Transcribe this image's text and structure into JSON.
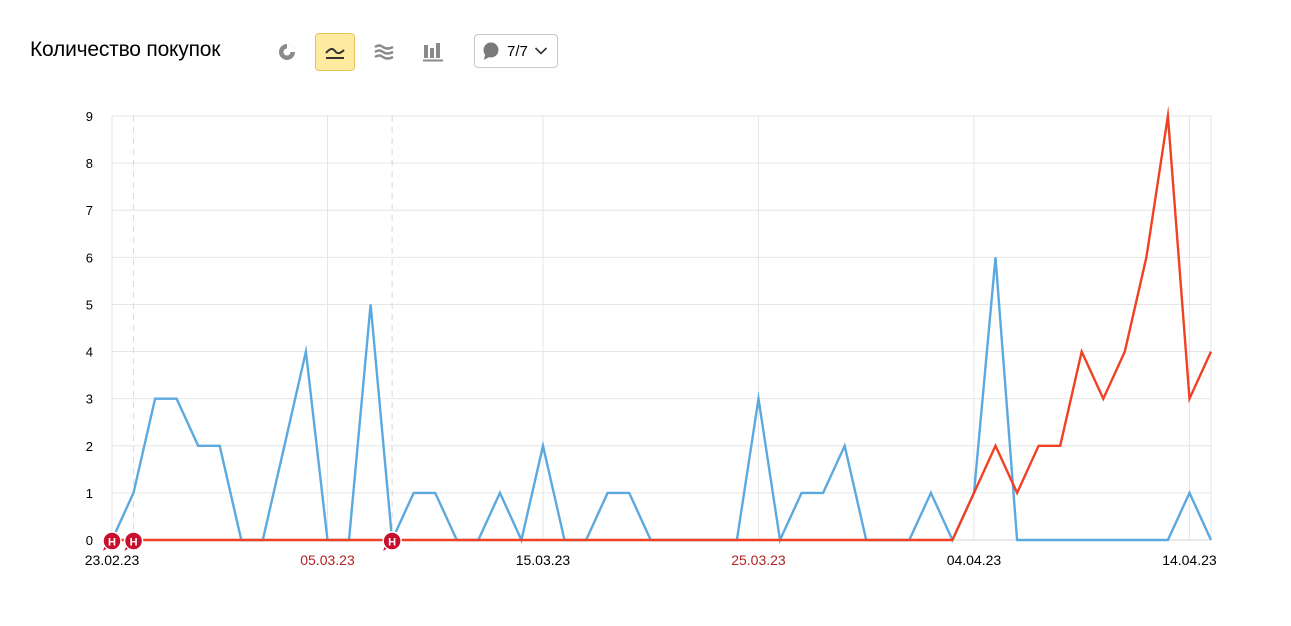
{
  "header": {
    "title": "Количество покупок",
    "notes_count": "7/7"
  },
  "toolbar": {
    "buttons": [
      {
        "icon": "pie-chart-icon",
        "active": false
      },
      {
        "icon": "line-chart-icon",
        "active": true
      },
      {
        "icon": "area-chart-icon",
        "active": false
      },
      {
        "icon": "bar-chart-icon",
        "active": false
      }
    ]
  },
  "colors": {
    "series_blue": "#5ca9e0",
    "series_red": "#f04124",
    "note_marker": "#c8102e",
    "holiday_label": "#b22222",
    "active_button": "#ffeba0"
  },
  "chart_data": {
    "type": "line",
    "x": [
      "23.02.23",
      "24.02.23",
      "25.02.23",
      "26.02.23",
      "27.02.23",
      "28.02.23",
      "01.03.23",
      "02.03.23",
      "03.03.23",
      "04.03.23",
      "05.03.23",
      "06.03.23",
      "07.03.23",
      "08.03.23",
      "09.03.23",
      "10.03.23",
      "11.03.23",
      "12.03.23",
      "13.03.23",
      "14.03.23",
      "15.03.23",
      "16.03.23",
      "17.03.23",
      "18.03.23",
      "19.03.23",
      "20.03.23",
      "21.03.23",
      "22.03.23",
      "23.03.23",
      "24.03.23",
      "25.03.23",
      "26.03.23",
      "27.03.23",
      "28.03.23",
      "29.03.23",
      "30.03.23",
      "31.03.23",
      "01.04.23",
      "02.04.23",
      "03.04.23",
      "04.04.23",
      "05.04.23",
      "06.04.23",
      "07.04.23",
      "08.04.23",
      "09.04.23",
      "10.04.23",
      "11.04.23",
      "12.04.23",
      "13.04.23",
      "14.04.23",
      "15.04.23"
    ],
    "series": [
      {
        "color": "#5ca9e0",
        "values": [
          0,
          1,
          3,
          3,
          2,
          2,
          0,
          0,
          2,
          4,
          0,
          0,
          5,
          0,
          1,
          1,
          0,
          0,
          1,
          0,
          2,
          0,
          0,
          1,
          1,
          0,
          0,
          0,
          0,
          0,
          3,
          0,
          1,
          1,
          2,
          0,
          0,
          0,
          1,
          0,
          1,
          6,
          0,
          0,
          0,
          0,
          0,
          0,
          0,
          0,
          1,
          0
        ]
      },
      {
        "color": "#f04124",
        "values": [
          0,
          0,
          0,
          0,
          0,
          0,
          0,
          0,
          0,
          0,
          0,
          0,
          0,
          0,
          0,
          0,
          0,
          0,
          0,
          0,
          0,
          0,
          0,
          0,
          0,
          0,
          0,
          0,
          0,
          0,
          0,
          0,
          0,
          0,
          0,
          0,
          0,
          0,
          0,
          0,
          1,
          2,
          1,
          2,
          2,
          4,
          3,
          4,
          6,
          9,
          3,
          4
        ]
      }
    ],
    "ylim": [
      0,
      9
    ],
    "yticks": [
      "0",
      "1",
      "2",
      "3",
      "4",
      "5",
      "6",
      "7",
      "8",
      "9"
    ],
    "xticks": [
      {
        "index": 0,
        "label": "23.02.23",
        "holiday": false
      },
      {
        "index": 10,
        "label": "05.03.23",
        "holiday": true
      },
      {
        "index": 20,
        "label": "15.03.23",
        "holiday": false
      },
      {
        "index": 30,
        "label": "25.03.23",
        "holiday": true
      },
      {
        "index": 40,
        "label": "04.04.23",
        "holiday": false
      },
      {
        "index": 50,
        "label": "14.04.23",
        "holiday": false
      }
    ],
    "notes": [
      {
        "index": 0,
        "label": "Н"
      },
      {
        "index": 1,
        "label": "Н"
      },
      {
        "index": 13,
        "label": "Н"
      }
    ],
    "grid": true
  }
}
